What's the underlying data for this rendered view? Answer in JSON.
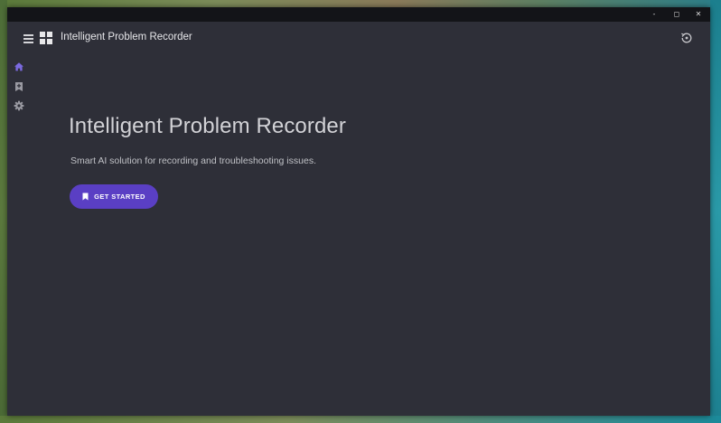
{
  "window": {
    "caption": {
      "minimize_glyph": "‐",
      "maximize_glyph": "◻",
      "close_glyph": "✕"
    }
  },
  "header": {
    "title": "Intelligent Problem Recorder",
    "menu_icon": "hamburger-menu-icon",
    "logo_icon": "windows-logo-icon",
    "history_icon": "history-icon"
  },
  "sidebar": {
    "items": [
      {
        "name": "home",
        "icon": "home-icon",
        "active": true
      },
      {
        "name": "new-recording",
        "icon": "add-bookmark-icon",
        "active": false
      },
      {
        "name": "settings",
        "icon": "gear-icon",
        "active": false
      }
    ]
  },
  "main": {
    "title": "Intelligent Problem Recorder",
    "subtitle": "Smart AI solution for recording and troubleshooting issues.",
    "cta_label": "GET STARTED",
    "cta_icon": "bookmark-icon"
  },
  "colors": {
    "accent": "#5a3fc4",
    "active_icon": "#7b6ae0",
    "background": "#2e2f38"
  }
}
